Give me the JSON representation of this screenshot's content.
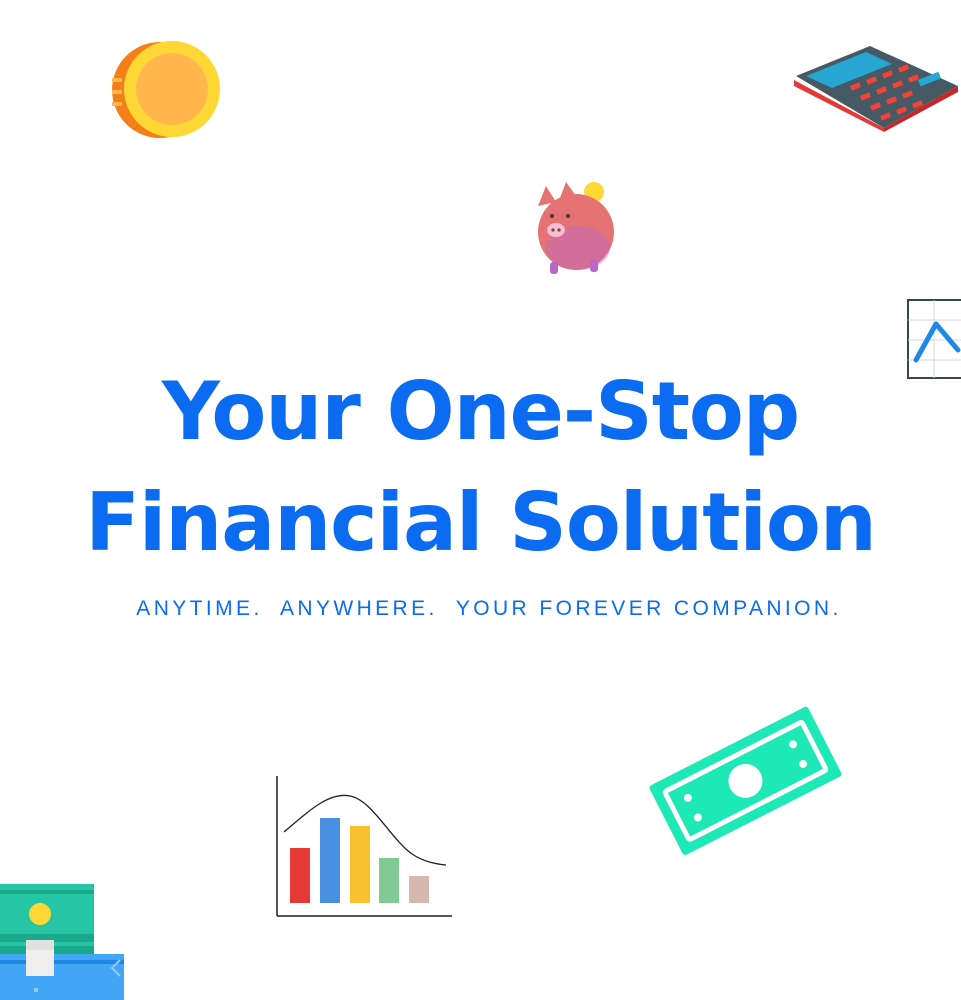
{
  "headline": {
    "line1": "Your One-Stop",
    "line2": "Financial Solution"
  },
  "tagline": "ANYTIME.  ANYWHERE.  YOUR FOREVER COMPANION.",
  "colors": {
    "brand_blue": "#0b6cf2",
    "coin": "#fbc02d",
    "cash_green": "#1de9b6",
    "piggy_pink": "#e57373"
  },
  "illustrations": [
    "coin-icon",
    "calculator-icon",
    "piggy-bank-icon",
    "line-chart-icon",
    "bar-chart-icon",
    "dollar-bill-icon",
    "money-stack-icon"
  ]
}
